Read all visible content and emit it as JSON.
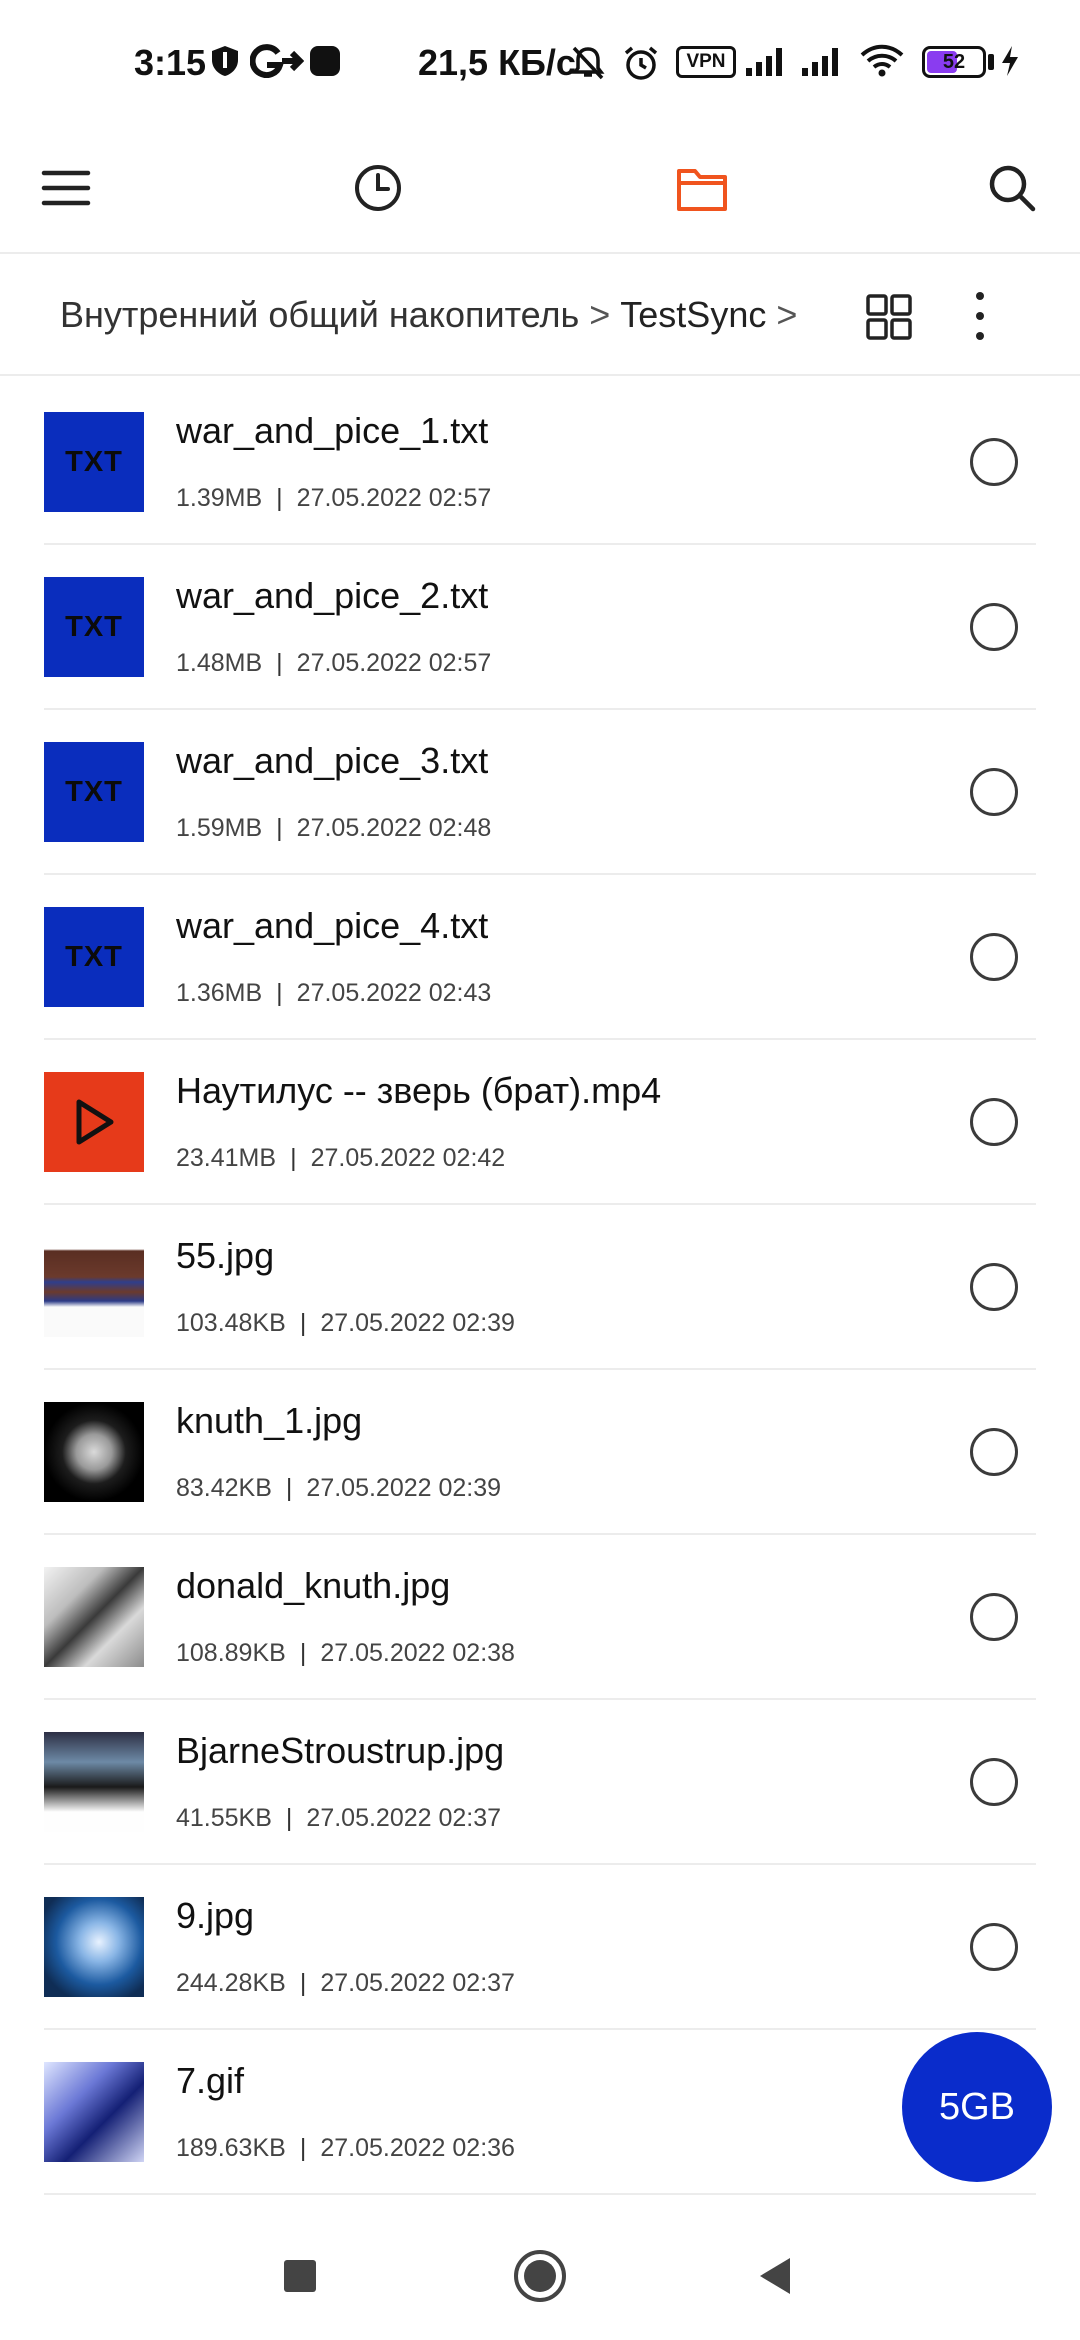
{
  "status_bar": {
    "time": "3:15",
    "speed": "21,5 КБ/с",
    "vpn_label": "VPN",
    "battery": "52",
    "icons": [
      "shield-icon",
      "g-logo-icon",
      "app-icon",
      "mute-icon",
      "alarm-icon",
      "vpn-icon",
      "signal-icon",
      "signal-icon",
      "wifi-icon",
      "battery-icon",
      "charging-icon"
    ]
  },
  "toolbar": {
    "icons": [
      "menu-icon",
      "recent-icon",
      "folder-icon",
      "search-icon"
    ],
    "active_tab_color": "#f0541e"
  },
  "breadcrumb": {
    "root": "Внутренний общий накопитель",
    "current": "TestSync",
    "separator": ">"
  },
  "files": [
    {
      "name": "war_and_pice_1.txt",
      "size": "1.39MB",
      "date": "27.05.2022 02:57",
      "type": "txt",
      "thumb_label": "TXT"
    },
    {
      "name": "war_and_pice_2.txt",
      "size": "1.48MB",
      "date": "27.05.2022 02:57",
      "type": "txt",
      "thumb_label": "TXT"
    },
    {
      "name": "war_and_pice_3.txt",
      "size": "1.59MB",
      "date": "27.05.2022 02:48",
      "type": "txt",
      "thumb_label": "TXT"
    },
    {
      "name": "war_and_pice_4.txt",
      "size": "1.36MB",
      "date": "27.05.2022 02:43",
      "type": "txt",
      "thumb_label": "TXT"
    },
    {
      "name": "Наутилус -- зверь (брат).mp4",
      "size": "23.41MB",
      "date": "27.05.2022 02:42",
      "type": "video"
    },
    {
      "name": "55.jpg",
      "size": "103.48KB",
      "date": "27.05.2022 02:39",
      "type": "image"
    },
    {
      "name": "knuth_1.jpg",
      "size": "83.42KB",
      "date": "27.05.2022 02:39",
      "type": "image"
    },
    {
      "name": "donald_knuth.jpg",
      "size": "108.89KB",
      "date": "27.05.2022 02:38",
      "type": "image"
    },
    {
      "name": "BjarneStroustrup.jpg",
      "size": "41.55KB",
      "date": "27.05.2022 02:37",
      "type": "image"
    },
    {
      "name": "9.jpg",
      "size": "244.28KB",
      "date": "27.05.2022 02:37",
      "type": "image"
    },
    {
      "name": "7.gif",
      "size": "189.63KB",
      "date": "27.05.2022 02:36",
      "type": "image"
    }
  ],
  "storage_button": {
    "label": "5GB",
    "color": "#0a2ccb"
  },
  "nav_bar": {
    "icons": [
      "recents-square-icon",
      "home-circle-icon",
      "back-triangle-icon"
    ]
  }
}
